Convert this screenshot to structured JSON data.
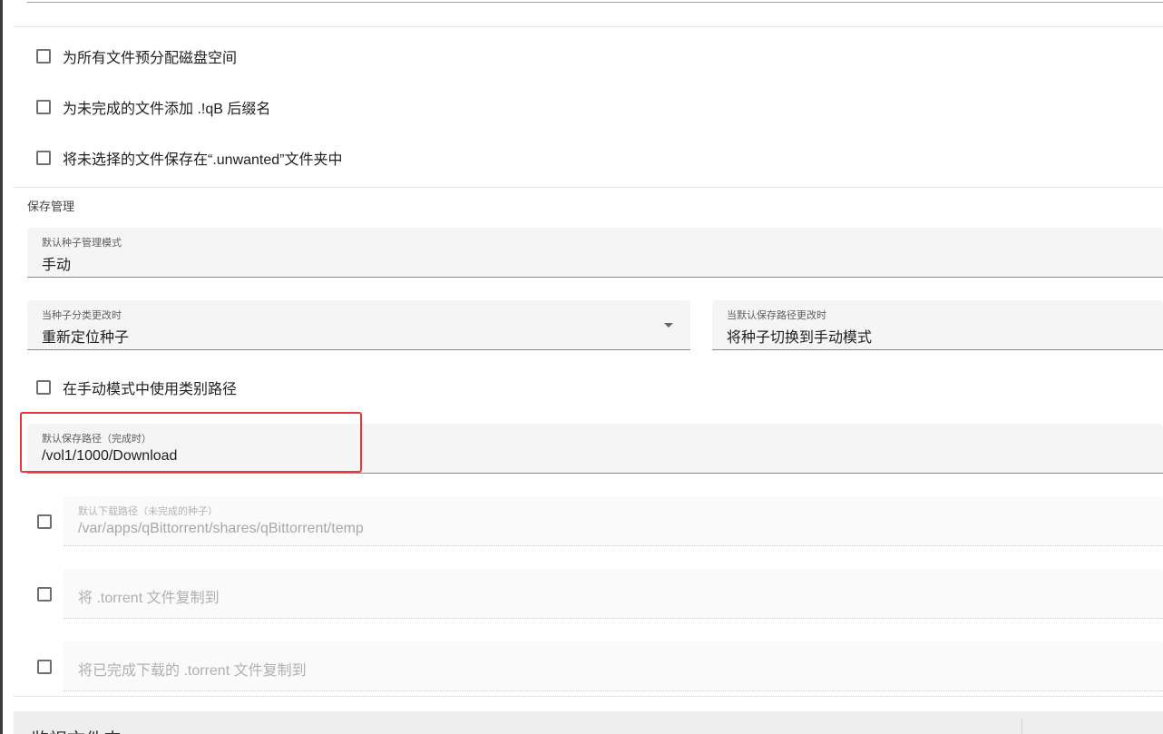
{
  "checkboxes_top": [
    {
      "label": "为所有文件预分配磁盘空间",
      "checked": false
    },
    {
      "label": "为未完成的文件添加 .!qB 后缀名",
      "checked": false
    },
    {
      "label": "将未选择的文件保存在“.unwanted”文件夹中",
      "checked": false
    }
  ],
  "save_management": {
    "section_title": "保存管理",
    "default_torrent_mode": {
      "label": "默认种子管理模式",
      "value": "手动"
    },
    "on_category_change": {
      "label": "当种子分类更改时",
      "value": "重新定位种子"
    },
    "on_default_path_change": {
      "label": "当默认保存路径更改时",
      "value": "将种子切换到手动模式"
    },
    "use_category_paths": {
      "label": "在手动模式中使用类别路径",
      "checked": false
    },
    "default_save_path": {
      "label": "默认保存路径（完成时）",
      "value": "/vol1/1000/Download"
    },
    "temp_path": {
      "checked": false,
      "label": "默认下载路径（未完成的种子）",
      "value": "/var/apps/qBittorrent/shares/qBittorrent/temp"
    },
    "copy_torrent": {
      "checked": false,
      "placeholder": "将 .torrent 文件复制到"
    },
    "copy_finished_torrent": {
      "checked": false,
      "placeholder": "将已完成下载的 .torrent 文件复制到"
    }
  },
  "bottom_panel": {
    "title": "监视文件夹"
  },
  "colors": {
    "highlight": "#e53935",
    "field_bg": "#f5f5f5"
  }
}
